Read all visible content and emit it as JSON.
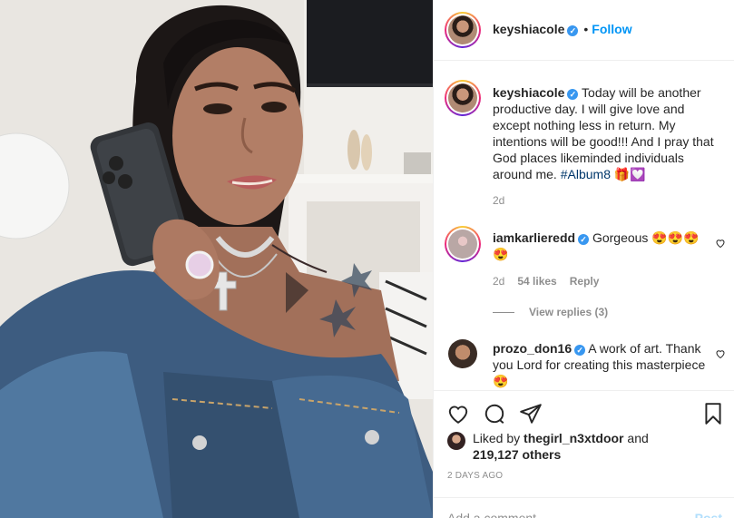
{
  "header": {
    "username": "keyshiacole",
    "follow_label": "Follow",
    "dot": "•"
  },
  "caption": {
    "username": "keyshiacole",
    "text": "Today will be another productive day. I will give love and except nothing less in return. My intentions will be good!!! And I pray that God places likeminded individuals around me.",
    "hashtag": "#Album8",
    "emojis": "🎁💟",
    "time": "2d"
  },
  "comments": [
    {
      "username": "iamkarlieredd",
      "text": "Gorgeous 😍😍😍😍",
      "time": "2d",
      "likes": "54 likes",
      "reply_label": "Reply",
      "view_replies": "View replies (3)"
    },
    {
      "username": "prozo_don16",
      "text": "A work of art. Thank you Lord for creating this masterpiece 😍"
    }
  ],
  "likes": {
    "prefix": "Liked by",
    "user": "thegirl_n3xtdoor",
    "and": "and",
    "count": "219,127 others"
  },
  "posted_ago": "2 DAYS AGO",
  "add_comment": {
    "placeholder": "Add a comment...",
    "post_label": "Post"
  },
  "colors": {
    "accent": "#0095f6",
    "verified": "#3897f0",
    "muted": "#8e8e8e",
    "hashtag": "#00376b"
  }
}
